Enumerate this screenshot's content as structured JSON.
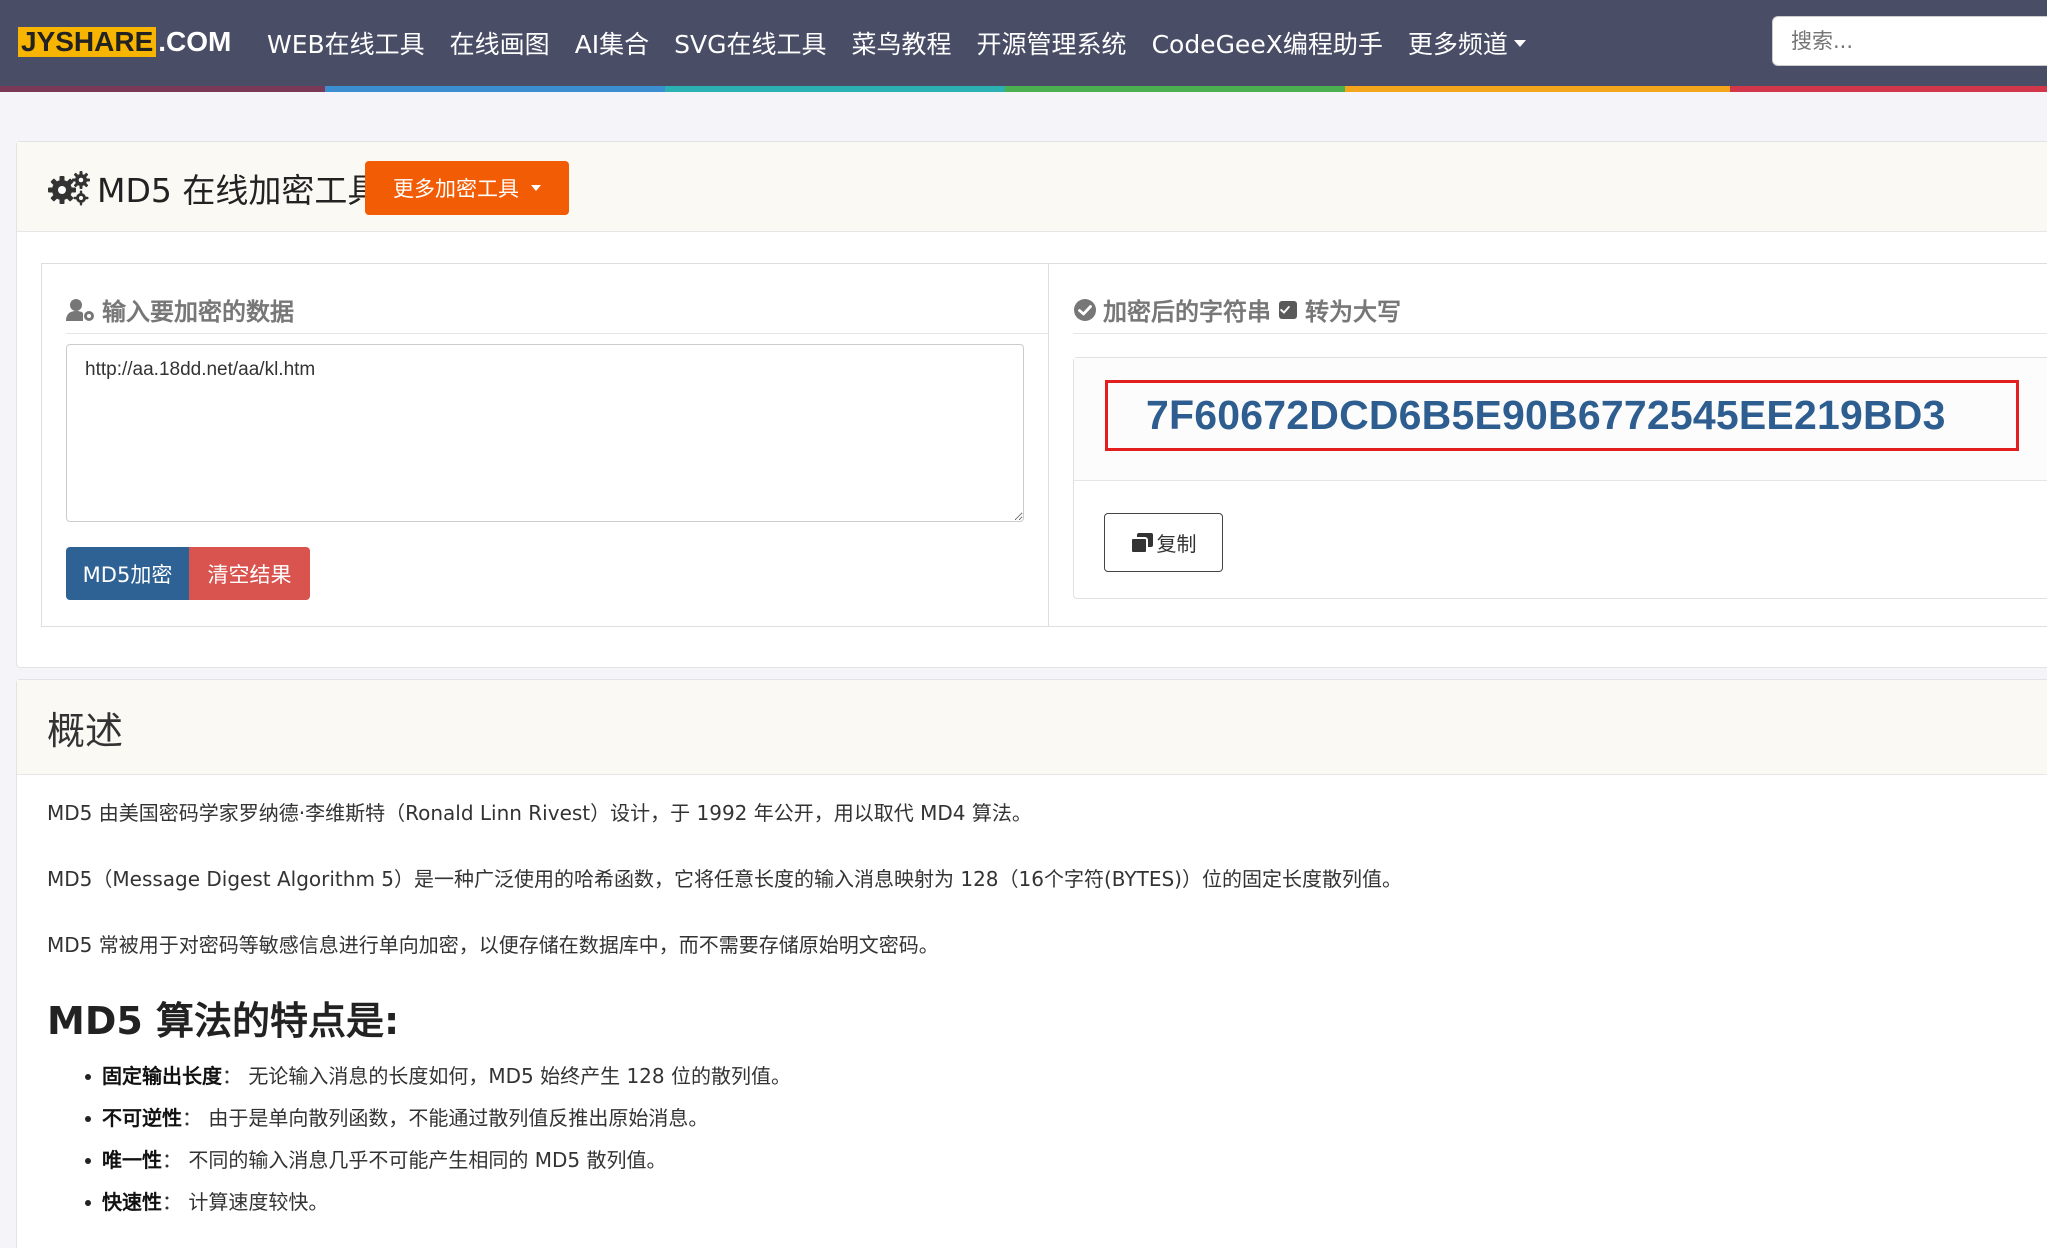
{
  "navbar": {
    "brand_left": "JYSHARE",
    "brand_right": ".COM",
    "items": [
      "WEB在线工具",
      "在线画图",
      "AI集合",
      "SVG在线工具",
      "菜鸟教程",
      "开源管理系统",
      "CodeGeeX编程助手",
      "更多频道"
    ],
    "search_placeholder": "搜索...",
    "strip_colors": [
      "#7a3a57",
      "#3b8fd1",
      "#2bb0b4",
      "#4cb050",
      "#f3a61c",
      "#d1364b"
    ]
  },
  "tool": {
    "title": "MD5 在线加密工具",
    "more_button": "更多加密工具",
    "input_panel_title": "输入要加密的数据",
    "input_value": "http://aa.18dd.net/aa/kl.htm",
    "encrypt_button": "MD5加密",
    "clear_button": "清空结果",
    "output_panel_title": "加密后的字符串",
    "uppercase_label": "转为大写",
    "result": "7F60672DCD6B5E90B6772545EE219BD3",
    "copy_button": "复制"
  },
  "overview": {
    "title": "概述",
    "paragraphs": [
      "MD5 由美国密码学家罗纳德·李维斯特（Ronald Linn Rivest）设计，于 1992 年公开，用以取代 MD4 算法。",
      "MD5（Message Digest Algorithm 5）是一种广泛使用的哈希函数，它将任意长度的输入消息映射为 128（16个字符(BYTES)）位的固定长度散列值。",
      "MD5 常被用于对密码等敏感信息进行单向加密，以便存储在数据库中，而不需要存储原始明文密码。"
    ],
    "features_title": "MD5 算法的特点是:",
    "features": [
      {
        "name": "固定输出长度",
        "desc": "： 无论输入消息的长度如何，MD5 始终产生 128 位的散列值。"
      },
      {
        "name": "不可逆性",
        "desc": "： 由于是单向散列函数，不能通过散列值反推出原始消息。"
      },
      {
        "name": "唯一性",
        "desc": "： 不同的输入消息几乎不可能产生相同的 MD5 散列值。"
      },
      {
        "name": "快速性",
        "desc": "： 计算速度较快。"
      }
    ]
  }
}
